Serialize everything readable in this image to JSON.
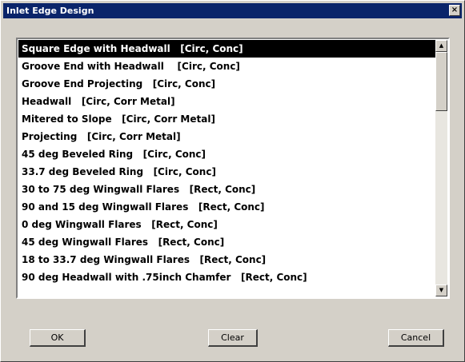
{
  "window": {
    "title": "Inlet Edge Design",
    "close_label": "×"
  },
  "list": {
    "selected_index": 0,
    "items": [
      "Square Edge with Headwall   [Circ, Conc]",
      "Groove End with Headwall    [Circ, Conc]",
      "Groove End Projecting   [Circ, Conc]",
      "Headwall   [Circ, Corr Metal]",
      "Mitered to Slope   [Circ, Corr Metal]",
      "Projecting   [Circ, Corr Metal]",
      "45 deg Beveled Ring   [Circ, Conc]",
      "33.7 deg Beveled Ring   [Circ, Conc]",
      "30 to 75 deg Wingwall Flares   [Rect, Conc]",
      "90 and 15 deg Wingwall Flares   [Rect, Conc]",
      "0 deg Wingwall Flares   [Rect, Conc]",
      "45 deg Wingwall Flares   [Rect, Conc]",
      "18 to 33.7 deg Wingwall Flares   [Rect, Conc]",
      "90 deg Headwall with .75inch Chamfer   [Rect, Conc]"
    ]
  },
  "scrollbar": {
    "up_icon": "triangle-up",
    "down_icon": "triangle-down",
    "up_glyph": "▲",
    "down_glyph": "▼"
  },
  "buttons": {
    "ok_label": "OK",
    "clear_label": "Clear",
    "cancel_label": "Cancel"
  },
  "colors": {
    "titlebar": "#0a246a",
    "selection": "#000000",
    "dialog_face": "#d4d0c8"
  }
}
